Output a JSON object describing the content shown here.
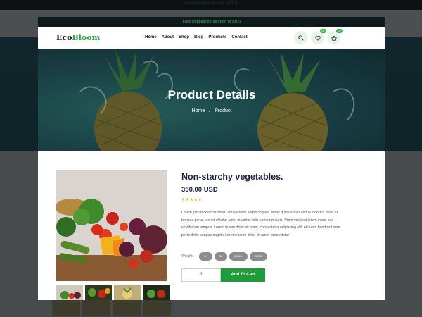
{
  "background": {
    "topbar_text": "Free shipping for all order of $105"
  },
  "promo": {
    "text": "Free shipping for all order of $105"
  },
  "nav": {
    "logo_prefix": "Eco",
    "logo_suffix": "Bloom",
    "menu": [
      "Home",
      "About",
      "Shop",
      "Blog",
      "Products",
      "Contact"
    ],
    "wishlist_count": "06",
    "cart_count": "02",
    "icons": [
      "search-icon",
      "heart-icon",
      "basket-icon"
    ]
  },
  "hero": {
    "title": "Product Details",
    "breadcrumb_home": "Home",
    "breadcrumb_sep": "/",
    "breadcrumb_current": "Product"
  },
  "product": {
    "title": "Non-starchy vegetables.",
    "price": "350.00 USD",
    "rating": 5,
    "rating_text": "★★★★★",
    "description": "Lorem ipsum dolor sit amet, consectetur adipiscing elit. Nunc quis ultrices lectus lobortis, dolor et tempus porta, leo mi efficitur ante, in varius felis sem ut mauris. Proin volutpat lorem inorci sed vestibulum tempus. Lorem ipsum dolor sit amet, consectetur adipiscing elit. Aliquam hendrerit sem porta dolor congue sagittis Lorem ipsum dolor sit amet consectetur",
    "weight_label": "Weight :",
    "weights": [
      "1K",
      "2L",
      "500ML",
      "300ML"
    ],
    "quantity": "1",
    "add_to_cart": "Add To Cart"
  },
  "colors": {
    "brand_green": "#2eab45",
    "button_green": "#1b9e38",
    "star": "#f2a900",
    "title_navy": "#1c2340"
  }
}
